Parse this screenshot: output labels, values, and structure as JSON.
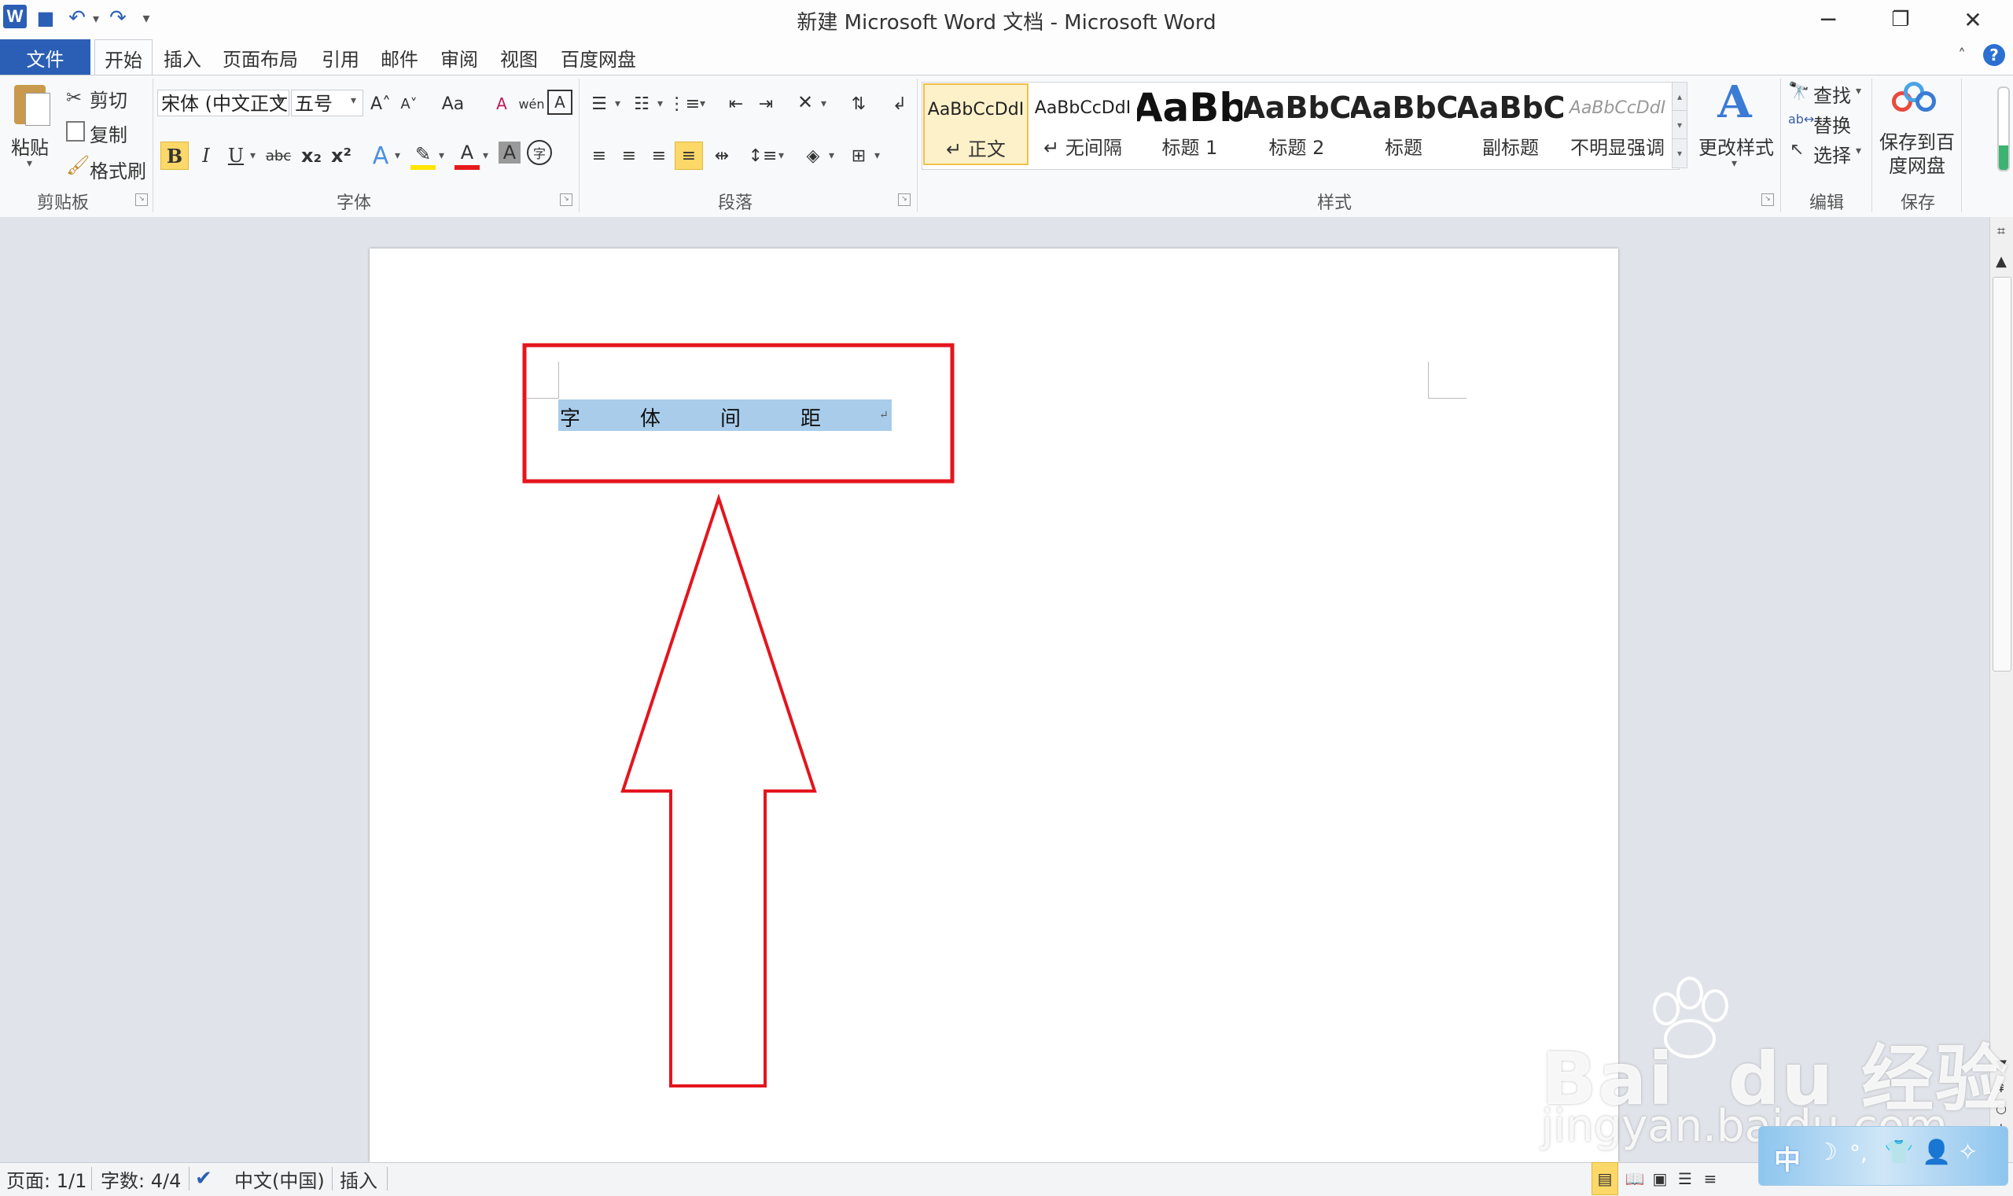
{
  "window": {
    "title": "新建 Microsoft Word 文档 - Microsoft Word",
    "app_icon_letter": "W",
    "minimize": "─",
    "restore": "❐",
    "close": "✕"
  },
  "quick_access": {
    "save": "💾",
    "undo": "↶",
    "redo": "↷",
    "customize": "▾"
  },
  "tabs": {
    "file": "文件",
    "items": [
      "开始",
      "插入",
      "页面布局",
      "引用",
      "邮件",
      "审阅",
      "视图",
      "百度网盘"
    ]
  },
  "clipboard": {
    "paste": "粘贴",
    "cut": "剪切",
    "copy": "复制",
    "format_painter": "格式刷",
    "group_label": "剪贴板"
  },
  "font": {
    "font_name": "宋体 (中文正文",
    "font_size": "五号",
    "group_label": "字体",
    "bold": "B",
    "italic": "I",
    "underline": "U",
    "strikethrough": "abc",
    "subscript": "x₂",
    "superscript": "x²",
    "grow": "A˄",
    "shrink": "A˅",
    "change_case": "Aa",
    "clear_format": "A",
    "phonetic": "wén",
    "char_border": "A",
    "text_effect": "A",
    "highlight": "✎",
    "font_color": "A",
    "char_shading": "A",
    "enclose": "字"
  },
  "paragraph": {
    "group_label": "段落"
  },
  "styles": {
    "group_label": "样式",
    "change_styles": "更改样式",
    "tiles": [
      {
        "sample": "AaBbCcDdI",
        "name": "↵ 正文"
      },
      {
        "sample": "AaBbCcDdI",
        "name": "↵ 无间隔"
      },
      {
        "sample": "AaBb",
        "name": "标题 1"
      },
      {
        "sample": "AaBbC",
        "name": "标题 2"
      },
      {
        "sample": "AaBbC",
        "name": "标题"
      },
      {
        "sample": "AaBbC",
        "name": "副标题"
      },
      {
        "sample": "AaBbCcDdI",
        "name": "不明显强调"
      }
    ]
  },
  "editing": {
    "find": "查找",
    "replace": "替换",
    "select": "选择",
    "group_label": "编辑"
  },
  "save_group": {
    "label_line1": "保存到百",
    "label_line2": "度网盘",
    "group_label": "保存"
  },
  "document": {
    "chars": [
      "字",
      "体",
      "间",
      "距"
    ],
    "para_mark": "↵"
  },
  "status": {
    "page": "页面: 1/1",
    "words": "字数: 4/4",
    "language": "中文(中国)",
    "mode": "插入"
  },
  "watermark": {
    "brand": "Bai  du 经验",
    "url": "jingyan.baidu.com",
    "ime_text": "中"
  },
  "colors": {
    "file_tab": "#2b5fb5",
    "selection": "#a8ccea",
    "annotation_red": "#e4151d",
    "highlight_yellow": "#ffe400",
    "font_red": "#e61a1a"
  }
}
